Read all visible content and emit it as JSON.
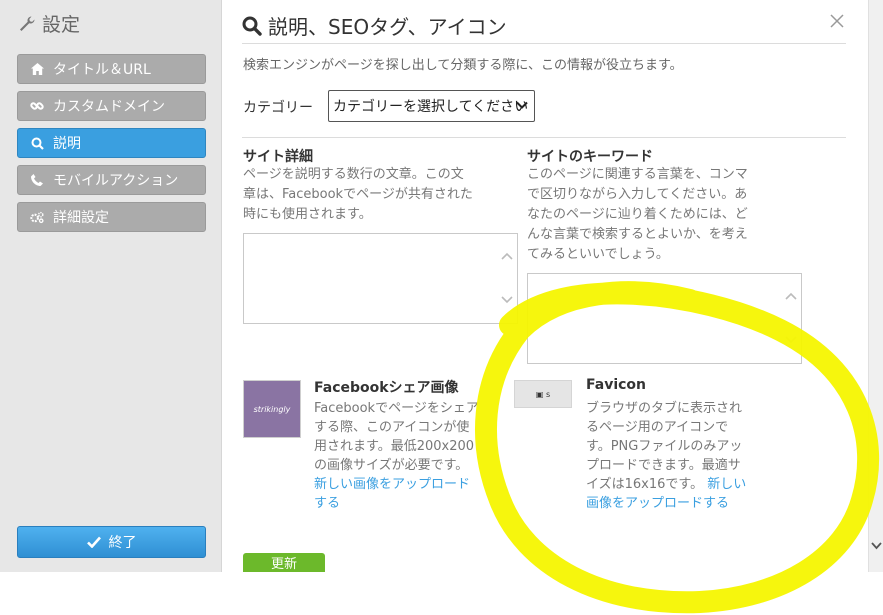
{
  "sidebar": {
    "title": "設定",
    "items": [
      {
        "label": "タイトル＆URL",
        "icon": "home-icon"
      },
      {
        "label": "カスタムドメイン",
        "icon": "link-icon"
      },
      {
        "label": "説明",
        "icon": "search-icon",
        "active": true
      },
      {
        "label": "モバイルアクション",
        "icon": "phone-icon"
      },
      {
        "label": "詳細設定",
        "icon": "gears-icon"
      }
    ],
    "done_label": "終了"
  },
  "main": {
    "title": "説明、SEOタグ、アイコン",
    "description": "検索エンジンがページを探し出して分類する際に、この情報が役立ちます。",
    "category_label": "カテゴリー",
    "category_value": "カテゴリーを選択してください",
    "site_detail": {
      "title": "サイト詳細",
      "desc_lines": [
        "ページを説明する数行の文章。この文",
        "章は、Facebookでページが共有された",
        "時にも使用されます。"
      ]
    },
    "site_keywords": {
      "title": "サイトのキーワード",
      "desc_lines": [
        "このページに関連する言葉を、コンマ",
        "で区切りながら入力してください。あ",
        "なたのページに辿り着くためには、ど",
        "んな言葉で検索するとよいか、を考え",
        "てみるといいでしょう。"
      ]
    },
    "facebook_image": {
      "title": "Facebookシェア画像",
      "thumb_text": "strikingly",
      "desc_lines": [
        "Facebookでページをシェア",
        "する際、このアイコンが使",
        "用されます。最低200x200",
        "の画像サイズが必要です。"
      ],
      "link_lines": [
        "新しい画像をアップロード",
        "する"
      ]
    },
    "favicon": {
      "title": "Favicon",
      "thumb_text": "▣ s",
      "desc_lines": [
        "ブラウザのタブに表示され",
        "るページ用のアイコンで",
        "す。PNGファイルのみアッ",
        "プロードできます。最適サ"
      ],
      "last_line_text": "イズは16x16です。",
      "last_line_link": "新しい",
      "link_line2": "画像をアップロードする"
    },
    "update_label": "更新"
  },
  "colors": {
    "accent_blue": "#3a9fe0",
    "sidebar_gray": "#ababab",
    "update_green": "#6cb92b",
    "annotation_yellow": "#f5f500"
  }
}
